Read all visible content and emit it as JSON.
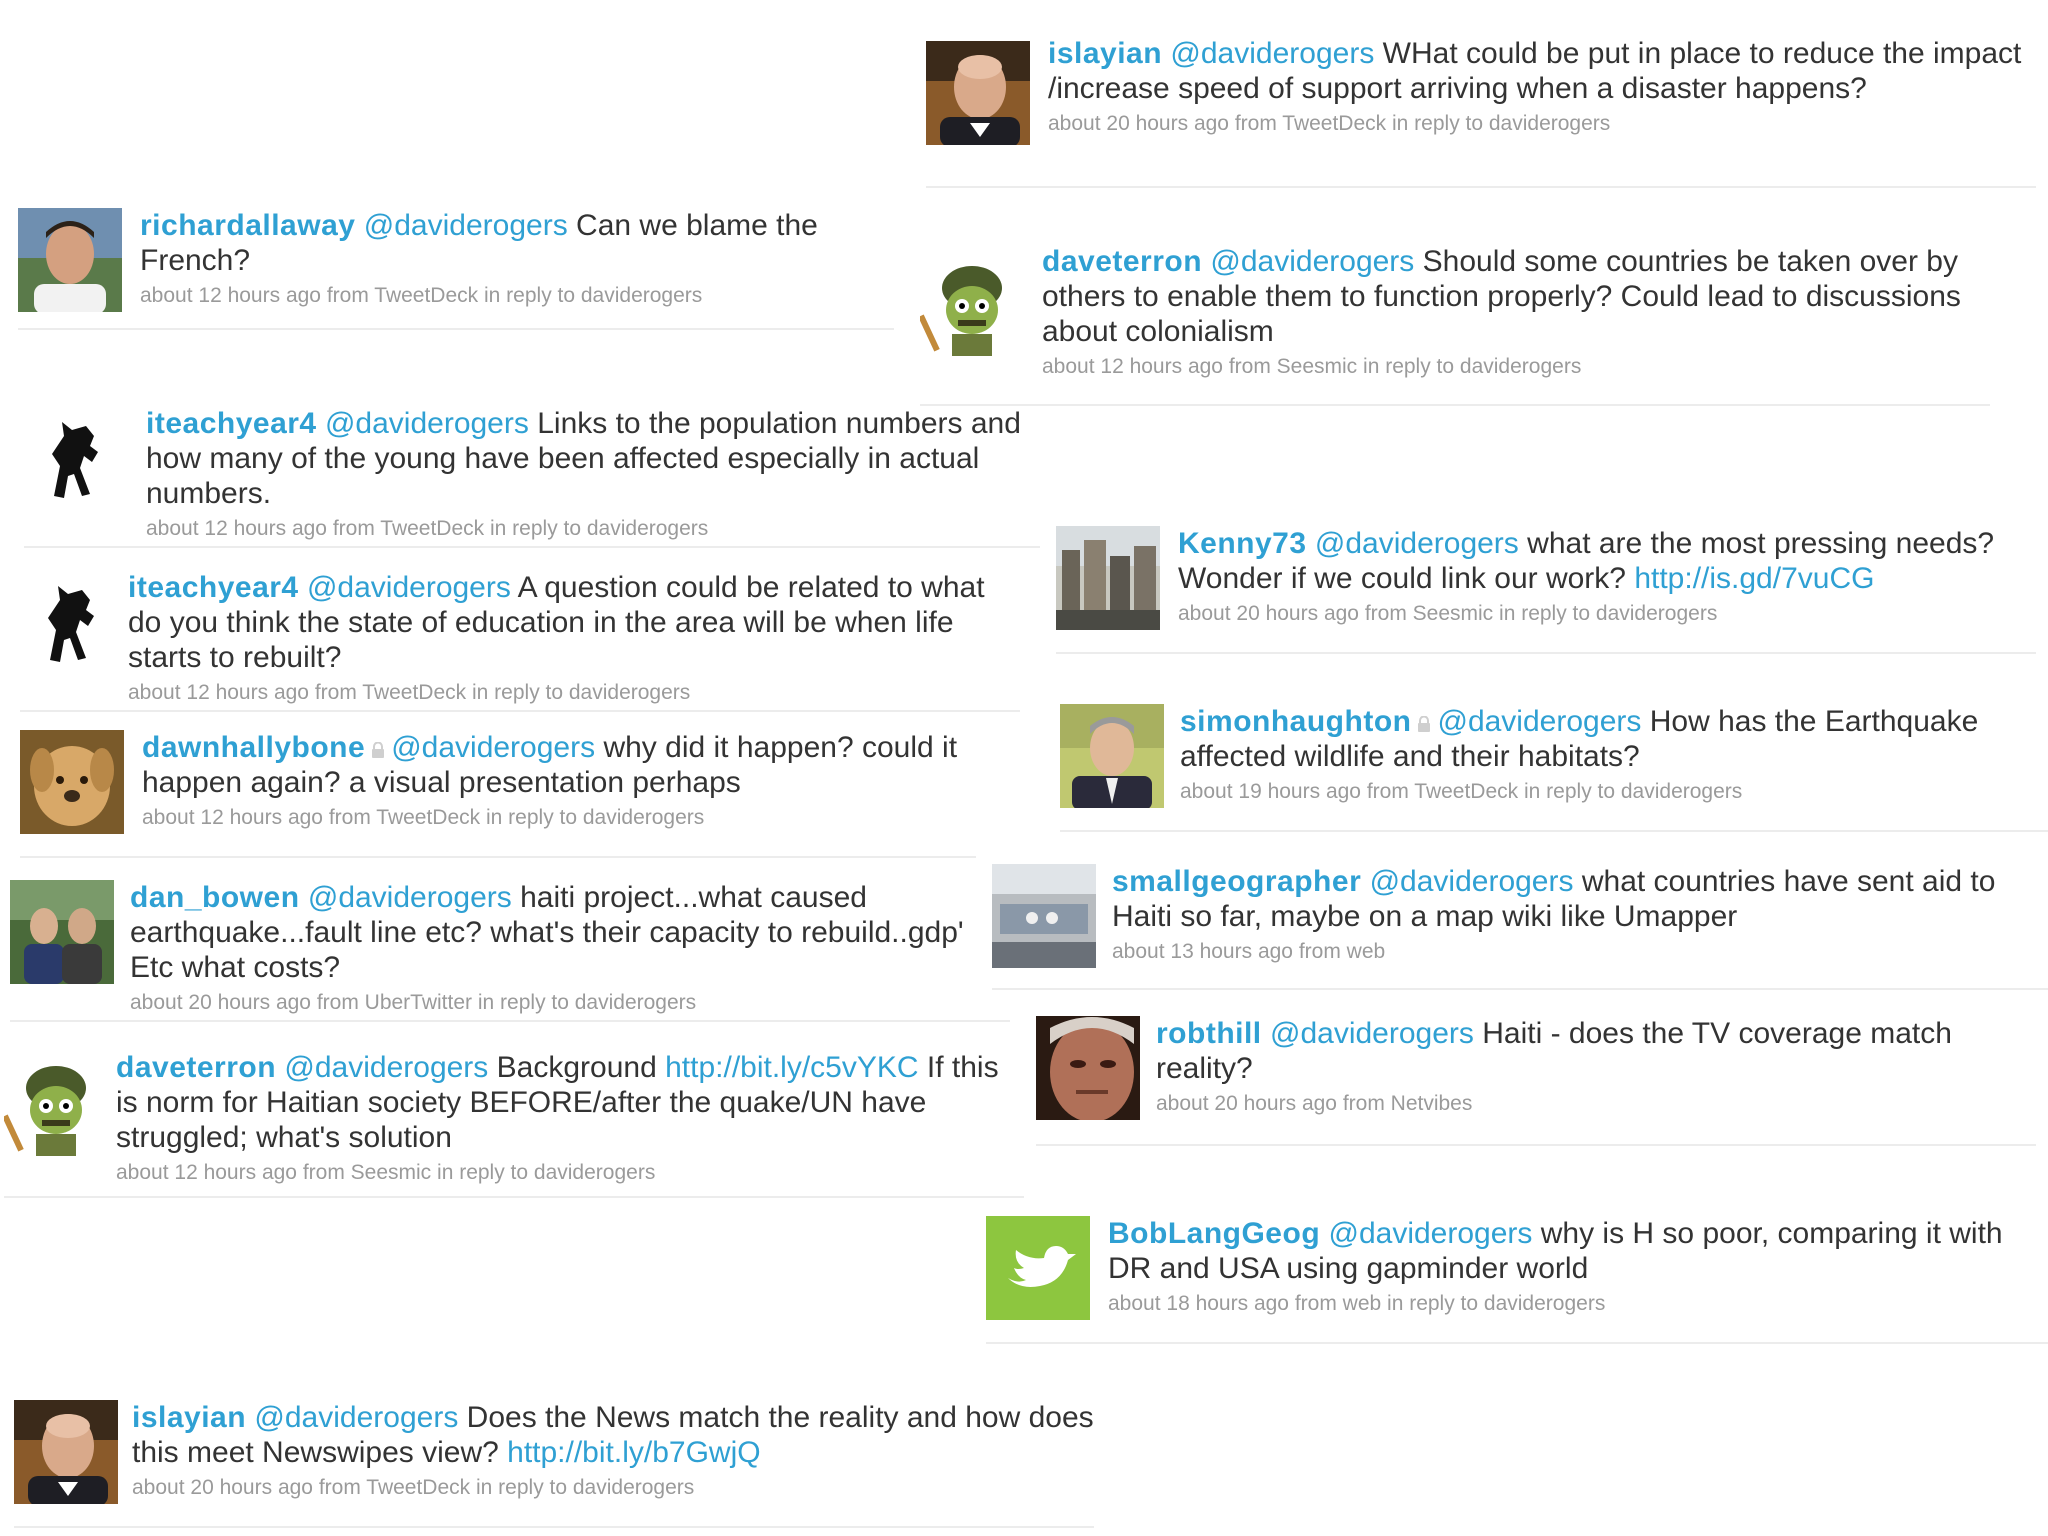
{
  "tweets": [
    {
      "user": "islayian",
      "mention": "@daviderogers",
      "pre": "WHat could be put in place to reduce the impact /increase speed of support arriving when a disaster happens?",
      "link": "",
      "post": "",
      "time": "about 20 hours ago",
      "from": "from TweetDeck",
      "reply": "in reply to daviderogers",
      "avatar": "bald-man-portrait",
      "locked": false
    },
    {
      "user": "richardallaway",
      "mention": "@daviderogers",
      "pre": "Can we blame the French?",
      "link": "",
      "post": "",
      "time": "about 12 hours ago",
      "from": "from TweetDeck",
      "reply": "in reply to daviderogers",
      "avatar": "man-portrait",
      "locked": false
    },
    {
      "user": "daveterron",
      "mention": "@daviderogers",
      "pre": "Should some countries be taken over by others to enable them to function properly? Could lead to discussions about colonialism",
      "link": "",
      "post": "",
      "time": "about 12 hours ago",
      "from": "from Seesmic",
      "reply": "in reply to daviderogers",
      "avatar": "cartoon-soldier",
      "locked": false
    },
    {
      "user": "iteachyear4",
      "mention": "@daviderogers",
      "pre": "Links to the population numbers and how many of the young have been affected especially in actual numbers.",
      "link": "",
      "post": "",
      "time": "about 12 hours ago",
      "from": "from TweetDeck",
      "reply": "in reply to daviderogers",
      "avatar": "prancing-horse",
      "locked": false
    },
    {
      "user": "Kenny73",
      "mention": "@daviderogers",
      "pre": "what are the most pressing needs? Wonder if we could link our work?",
      "link": "http://is.gd/7vuCG",
      "post": "",
      "time": "about 20 hours ago",
      "from": "from Seesmic",
      "reply": "in reply to daviderogers",
      "avatar": "city-photo",
      "locked": false
    },
    {
      "user": "iteachyear4",
      "mention": "@daviderogers",
      "pre": "A question could be related to what do you think the state of education in the area will be when life starts to rebuilt?",
      "link": "",
      "post": "",
      "time": "about 12 hours ago",
      "from": "from TweetDeck",
      "reply": "in reply to daviderogers",
      "avatar": "prancing-horse",
      "locked": false
    },
    {
      "user": "dawnhallybone",
      "mention": "@daviderogers",
      "pre": "why did it happen? could it happen again? a visual presentation perhaps",
      "link": "",
      "post": "",
      "time": "about 12 hours ago",
      "from": "from TweetDeck",
      "reply": "in reply to daviderogers",
      "avatar": "dog-photo",
      "locked": true
    },
    {
      "user": "simonhaughton",
      "mention": "@daviderogers",
      "pre": "How has the Earthquake affected wildlife and their habitats?",
      "link": "",
      "post": "",
      "time": "about 19 hours ago",
      "from": "from TweetDeck",
      "reply": "in reply to daviderogers",
      "avatar": "man-suit-portrait",
      "locked": true
    },
    {
      "user": "smallgeographer",
      "mention": "@daviderogers",
      "pre": "what countries have sent aid to Haiti so far, maybe on a map wiki like Umapper",
      "link": "",
      "post": "",
      "time": "about 13 hours ago",
      "from": "from web",
      "reply": "",
      "avatar": "room-photo",
      "locked": false
    },
    {
      "user": "dan_bowen",
      "mention": "@daviderogers",
      "pre": "haiti project...what caused earthquake...fault line etc? what's their capacity to rebuild..gdp' Etc what costs?",
      "link": "",
      "post": "",
      "time": "about 20 hours ago",
      "from": "from UberTwitter",
      "reply": "in reply to daviderogers",
      "avatar": "two-men-photo",
      "locked": false
    },
    {
      "user": "robthill",
      "mention": "@daviderogers",
      "pre": "Haiti - does the TV coverage match reality?",
      "link": "",
      "post": "",
      "time": "about 20 hours ago",
      "from": "from Netvibes",
      "reply": "",
      "avatar": "face-closeup",
      "locked": false
    },
    {
      "user": "daveterron",
      "mention": "@daviderogers",
      "pre": "Background",
      "link": "http://bit.ly/c5vYKC",
      "post": "If this is norm for Haitian society BEFORE/after the quake/UN have struggled; what's solution",
      "time": "about 12 hours ago",
      "from": "from Seesmic",
      "reply": "in reply to daviderogers",
      "avatar": "cartoon-soldier",
      "locked": false
    },
    {
      "user": "BobLangGeog",
      "mention": "@daviderogers",
      "pre": "why is H so poor, comparing it with DR and USA using gapminder world",
      "link": "",
      "post": "",
      "time": "about 18 hours ago",
      "from": "from web",
      "reply": "in reply to daviderogers",
      "avatar": "twitter-bird",
      "locked": false
    },
    {
      "user": "islayian",
      "mention": "@daviderogers",
      "pre": "Does the News match the reality and how does this meet Newswipes view?",
      "link": "http://bit.ly/b7GwjQ",
      "post": "",
      "time": "about 20 hours ago",
      "from": "from TweetDeck",
      "reply": "in reply to daviderogers",
      "avatar": "bald-man-portrait",
      "locked": false
    }
  ],
  "colors": {
    "link": "#2fa0d3",
    "text": "#333333",
    "meta": "#9a9a9a",
    "separator": "#ececec",
    "bird_bg": "#8dc63f"
  }
}
